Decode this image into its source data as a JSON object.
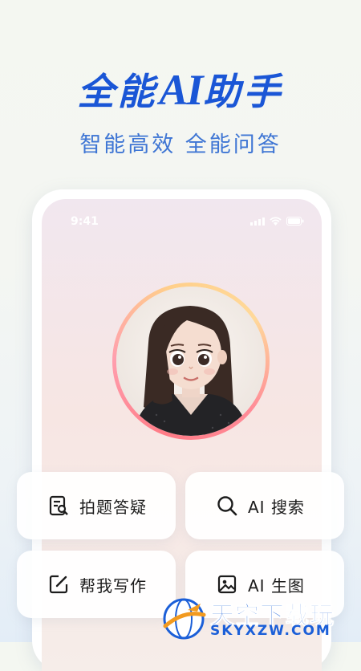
{
  "hero": {
    "title_pre": "全能",
    "title_ai": "AI",
    "title_post": "助手",
    "subtitle": "智能高效 全能问答"
  },
  "phone": {
    "status_time": "9:41"
  },
  "features": [
    {
      "label": "拍题答疑",
      "icon": "document-search-icon"
    },
    {
      "label": "AI 搜索",
      "icon": "search-icon"
    },
    {
      "label": "帮我写作",
      "icon": "edit-icon"
    },
    {
      "label": "AI 生图",
      "icon": "image-icon"
    }
  ],
  "watermark": {
    "text": "天空下载玩",
    "url": "SKYXZW.COM"
  },
  "colors": {
    "brand_blue": "#1a56d6",
    "subtitle_blue": "#3e75d4"
  }
}
